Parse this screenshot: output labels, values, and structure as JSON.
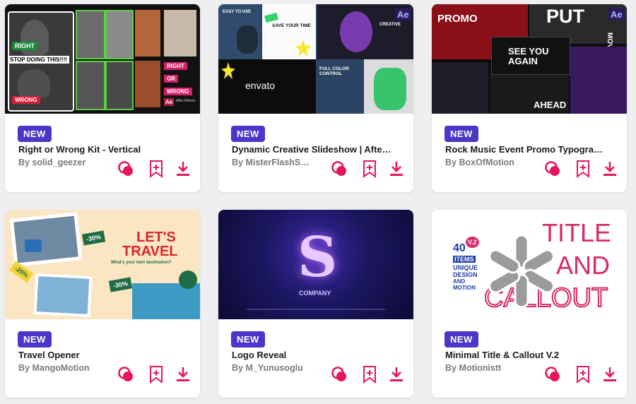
{
  "items": [
    {
      "badge": "NEW",
      "title": "Right or Wrong Kit - Vertical",
      "author": "By solid_geezer",
      "thumb_text": {
        "right": "RIGHT",
        "stop": "STOP DOING THIS!!!!",
        "wrong": "WRONG",
        "right2": "RIGHT",
        "or": "OR",
        "wrong2": "WRONG",
        "ae": "Ae",
        "after": "After Effects"
      }
    },
    {
      "badge": "NEW",
      "title": "Dynamic Creative Slideshow | After Effects",
      "author": "By MisterFlashStudio",
      "thumb_text": {
        "easy": "EASY TO USE",
        "save": "SAVE YOUR TIME",
        "creative": "CREATIVE",
        "envato": "envato",
        "full": "FULL COLOR CONTROL",
        "ae": "Ae"
      }
    },
    {
      "badge": "NEW",
      "title": "Rock Music Event Promo Typography",
      "author": "By BoxOfMotion",
      "thumb_text": {
        "promo": "PROMO",
        "put": "PUT",
        "ae": "Ae",
        "see": "SEE YOU AGAIN",
        "ahead": "AHEAD",
        "move": "MOVE ON"
      }
    },
    {
      "badge": "NEW",
      "title": "Travel Opener",
      "author": "By MangoMotion",
      "thumb_text": {
        "lets": "LET'S",
        "travel": "TRAVEL",
        "dest": "What's your next destination?",
        "d1": "-30%",
        "d2": "-20%",
        "d3": "-30%"
      }
    },
    {
      "badge": "NEW",
      "title": "Logo Reveal",
      "author": "By M_Yunusoglu",
      "thumb_text": {
        "company": "COMPANY"
      }
    },
    {
      "badge": "NEW",
      "title": "Minimal Title & Callout V.2",
      "author": "By Motionistt",
      "thumb_text": {
        "title": "TITLE",
        "and": "AND",
        "callout": "CALLOUT",
        "num": "40",
        "items": "ITEMS",
        "unique": "UNIQUE",
        "design": "DESIGN",
        "andsmall": "AND",
        "motion": "MOTION",
        "v2": "V.2"
      }
    }
  ],
  "action_icons": [
    "preview-icon",
    "bookmark-icon",
    "download-icon"
  ],
  "colors": {
    "accent": "#e5175b",
    "badge": "#4a36c8",
    "background": "#efeff1",
    "card": "#ffffff"
  }
}
